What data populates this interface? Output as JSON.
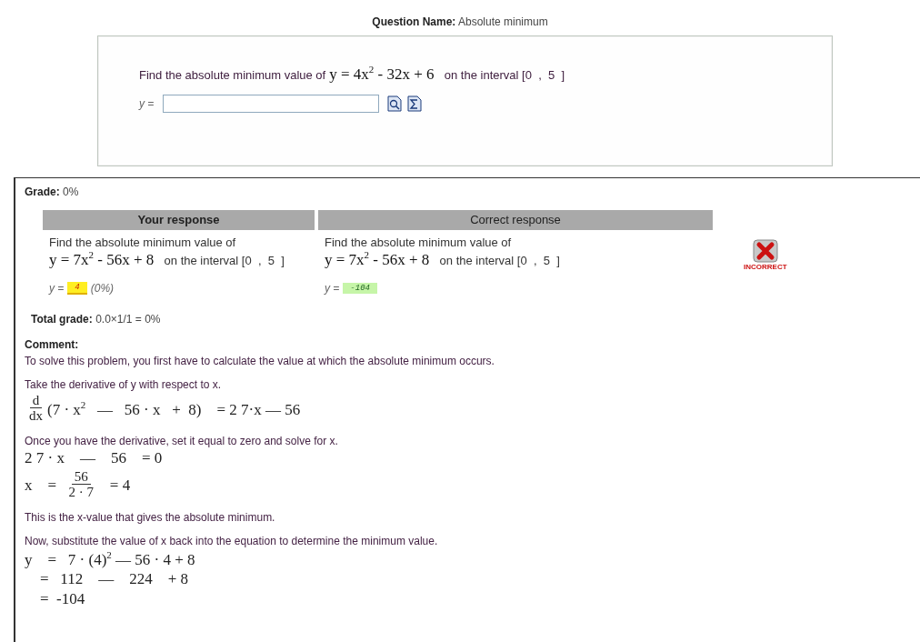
{
  "question_name": {
    "label": "Question Name:",
    "value": "Absolute minimum"
  },
  "question": {
    "prompt": "Find the absolute minimum value of",
    "equation": "y = 4x$^{2}$ - 32x + 6",
    "interval": "on the interval [0  ,  5  ]",
    "answer_label": "y ="
  },
  "grade": {
    "label": "Grade:",
    "value": "0%"
  },
  "responses": [
    {
      "heading": "Your response",
      "prompt": "Find the absolute minimum value of",
      "equation": "y = 7x$^{2}$ - 56x + 8",
      "interval": "on the interval [0  ,  5  ]",
      "answer_label": "y =",
      "answer": "4",
      "score": "(0%)",
      "correct": false
    },
    {
      "heading": "Correct response",
      "prompt": "Find the absolute minimum value of",
      "equation": "y = 7x$^{2}$ - 56x + 8",
      "interval": "on the interval [0  ,  5  ]",
      "answer_label": "y =",
      "answer": "-104",
      "correct": true
    }
  ],
  "result": {
    "kind": "incorrect",
    "label": "INCORRECT"
  },
  "total_grade": {
    "label": "Total grade:",
    "value": "0.0×1/1 = 0%"
  },
  "comment": {
    "label": "Comment:",
    "steps": [
      {
        "kind": "text",
        "text": "To solve this problem, you first have to calculate the value at which the absolute minimum occurs."
      },
      {
        "kind": "text",
        "text": "Take the derivative of y with respect to x."
      },
      {
        "kind": "fraction",
        "numerator": "d",
        "denominator": "dx",
        "after": "(7 · x$^{2}$   —   56 · x   +  8)    = 2 7·x — 56"
      },
      {
        "kind": "text",
        "text": "Once you have the derivative, set it equal to zero and solve for x."
      },
      {
        "kind": "math",
        "text": "2 7 · x    —    56    = 0"
      },
      {
        "kind": "fraction",
        "before": "x    =  ",
        "numerator": "56",
        "denominator": "2 · 7",
        "after": "   = 4"
      },
      {
        "kind": "text",
        "text": "This is the x-value that gives the absolute minimum."
      },
      {
        "kind": "text",
        "text": "Now, substitute the value of x back into the equation to determine the minimum value."
      },
      {
        "kind": "math",
        "text": "y    =   7 · (4)$^{2}$ — 56 · 4 + 8"
      },
      {
        "kind": "math",
        "text": "    =   112    —    224    + 8"
      },
      {
        "kind": "math",
        "text": "    =  -104"
      }
    ]
  }
}
